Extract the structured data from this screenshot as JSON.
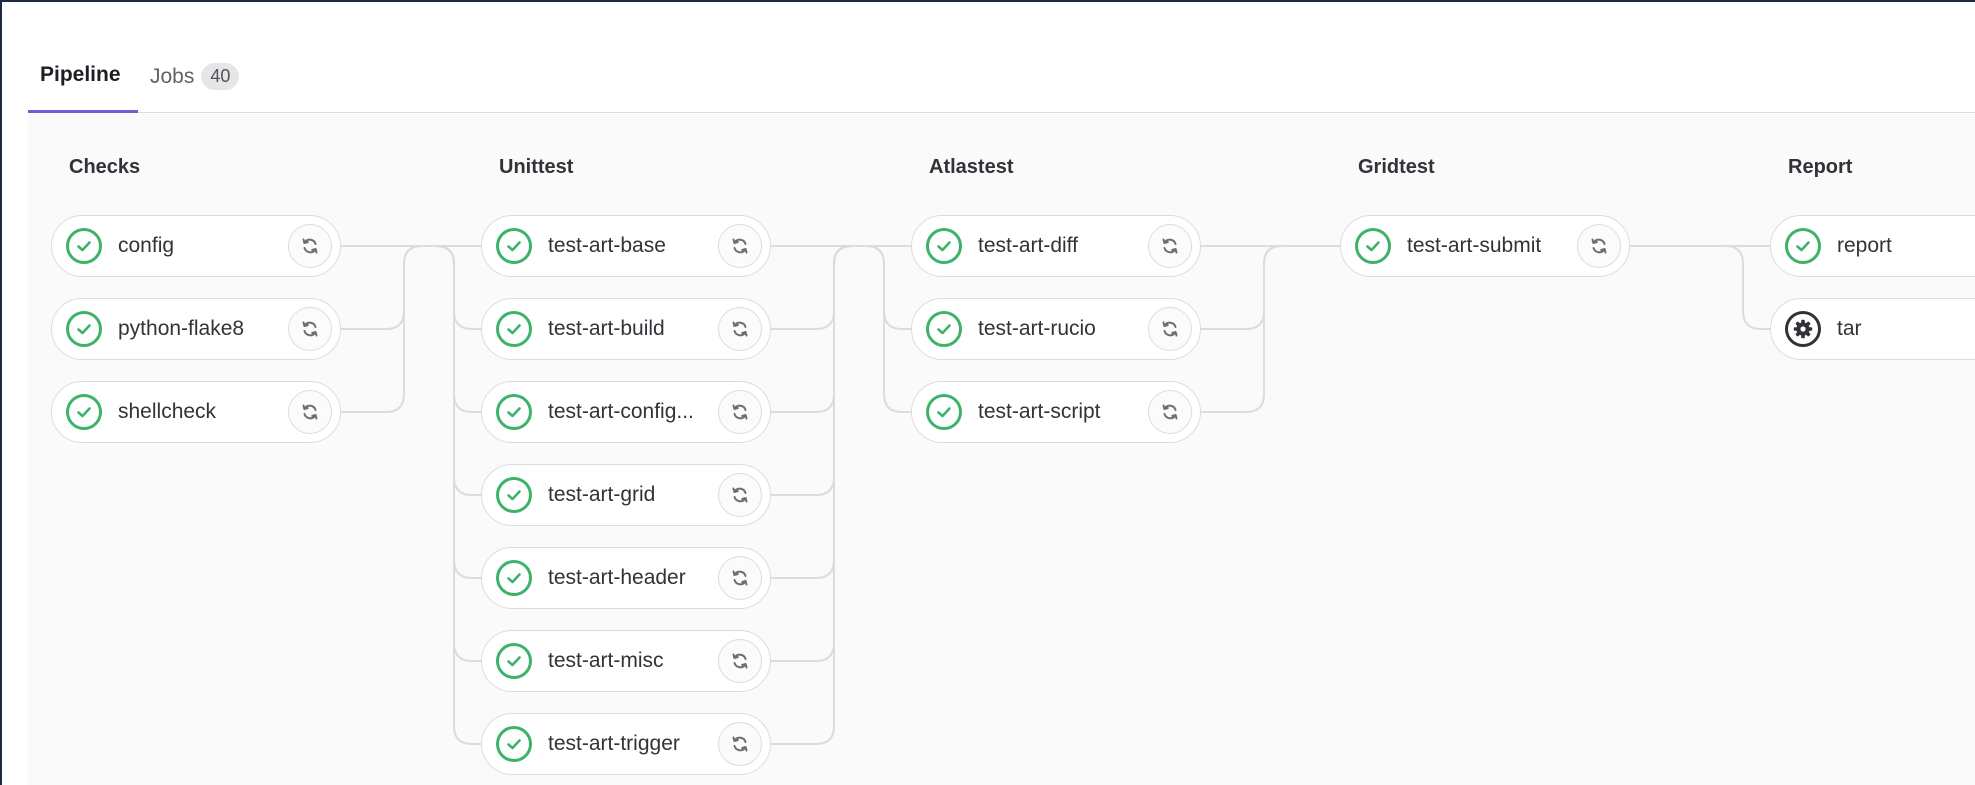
{
  "tabs": {
    "pipeline_label": "Pipeline",
    "jobs_label": "Jobs",
    "jobs_count": "40"
  },
  "colors": {
    "success": "#3db36a",
    "manual": "#333238",
    "active_tab": "#6b5fd3"
  },
  "stages": [
    {
      "title": "Checks",
      "jobs": [
        {
          "name": "config",
          "status": "success"
        },
        {
          "name": "python-flake8",
          "status": "success"
        },
        {
          "name": "shellcheck",
          "status": "success"
        }
      ]
    },
    {
      "title": "Unittest",
      "jobs": [
        {
          "name": "test-art-base",
          "status": "success"
        },
        {
          "name": "test-art-build",
          "status": "success"
        },
        {
          "name": "test-art-config...",
          "status": "success"
        },
        {
          "name": "test-art-grid",
          "status": "success"
        },
        {
          "name": "test-art-header",
          "status": "success"
        },
        {
          "name": "test-art-misc",
          "status": "success"
        },
        {
          "name": "test-art-trigger",
          "status": "success"
        }
      ]
    },
    {
      "title": "Atlastest",
      "jobs": [
        {
          "name": "test-art-diff",
          "status": "success"
        },
        {
          "name": "test-art-rucio",
          "status": "success"
        },
        {
          "name": "test-art-script",
          "status": "success"
        }
      ]
    },
    {
      "title": "Gridtest",
      "jobs": [
        {
          "name": "test-art-submit",
          "status": "success"
        }
      ]
    },
    {
      "title": "Report",
      "jobs": [
        {
          "name": "report",
          "status": "success"
        },
        {
          "name": "tar",
          "status": "manual"
        }
      ]
    }
  ],
  "icons": {
    "success": "check-circle-icon",
    "manual": "gear-icon",
    "retry": "retry-icon"
  }
}
